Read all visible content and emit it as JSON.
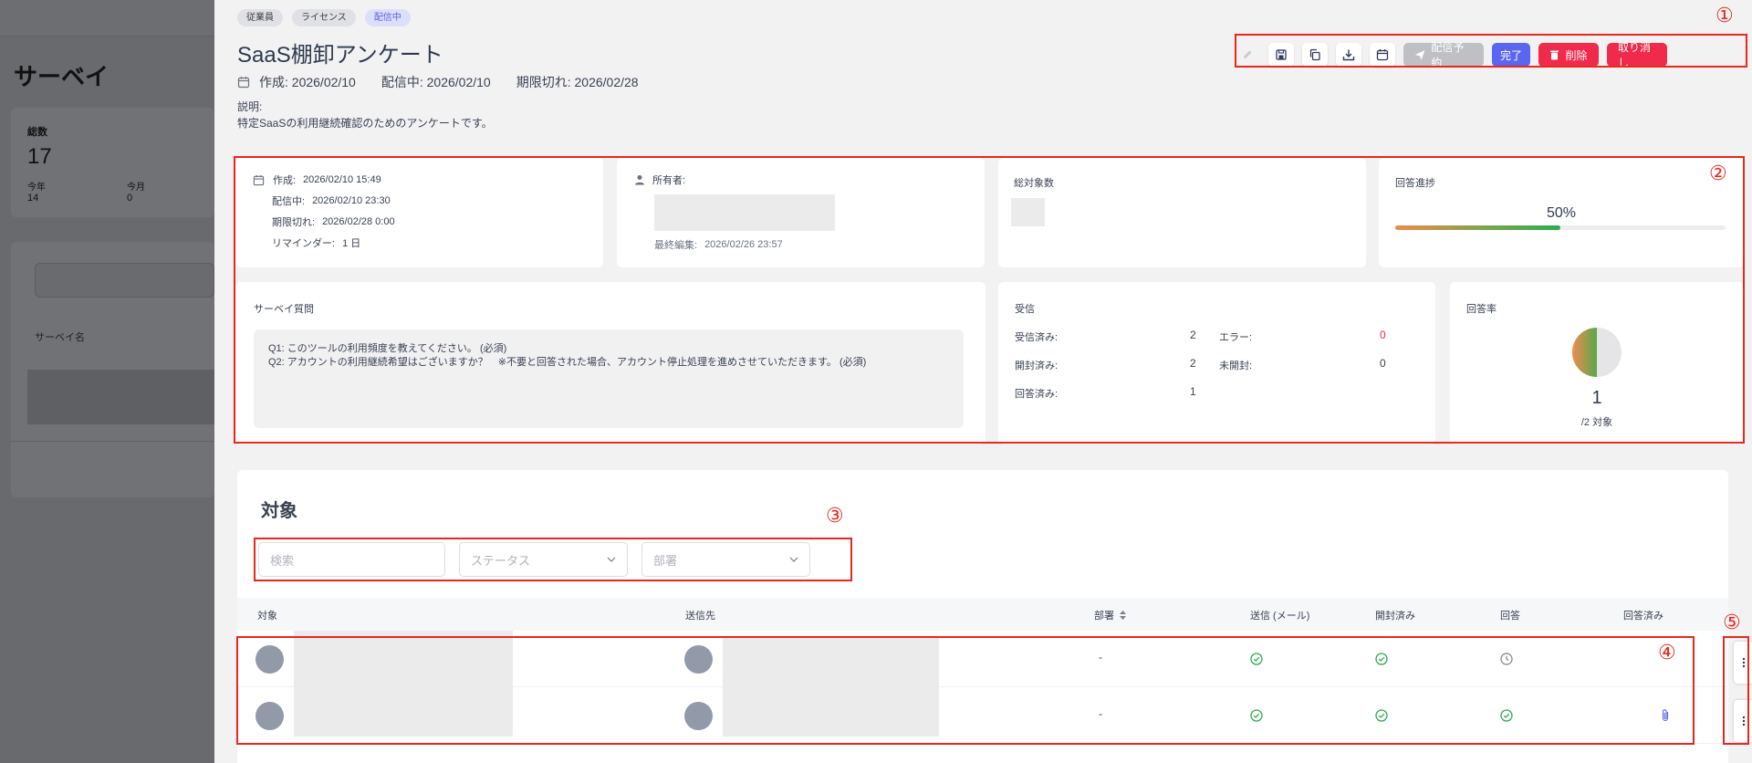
{
  "background": {
    "title": "サーベイ",
    "card_label": "総数",
    "card_value": "17",
    "this_year_label": "今年",
    "this_year_value": "14",
    "this_month_label": "今月",
    "this_month_value": "0",
    "column_survey_name": "サーベイ名"
  },
  "tags": [
    "従業員",
    "ライセンス",
    "配信中"
  ],
  "title": "SaaS棚卸アンケート",
  "meta": {
    "created": "作成: 2026/02/10",
    "distributing": "配信中: 2026/02/10",
    "expires": "期限切れ: 2026/02/28"
  },
  "description": {
    "label": "説明:",
    "text": "特定SaaSの利用継続確認のためのアンケートです。"
  },
  "toolbar": {
    "icons": [
      "edit-icon",
      "save-icon",
      "copy-icon",
      "download-icon",
      "calendar-icon"
    ],
    "schedule_label": "配信予約",
    "complete_label": "完了",
    "delete_label": "削除",
    "cancel_label": "取り消し"
  },
  "dates_card": {
    "created_label": "作成:",
    "created_value": "2026/02/10 15:49",
    "distributing_label": "配信中:",
    "distributing_value": "2026/02/10 23:30",
    "expires_label": "期限切れ:",
    "expires_value": "2026/02/28 0:00",
    "reminder_label": "リマインダー:",
    "reminder_value": "1 日"
  },
  "owner_card": {
    "label": "所有者:",
    "last_edit_label": "最終編集:",
    "last_edit_value": "2026/02/26 23:57"
  },
  "total_targets_card": {
    "label": "総対象数"
  },
  "progress_card": {
    "label": "回答進捗",
    "percent_text": "50%",
    "percent": 50
  },
  "questions_card": {
    "label": "サーベイ質問",
    "q1": "Q1:  このツールの利用頻度を教えてください。 (必須)",
    "q2": "Q2:  アカウントの利用継続希望はございますか？　※不要と回答された場合、アカウント停止処理を進めさせていただきます。 (必須)"
  },
  "receipt_card": {
    "label": "受信",
    "received_label": "受信済み:",
    "received_value": "2",
    "opened_label": "開封済み:",
    "opened_value": "2",
    "answered_label": "回答済み:",
    "answered_value": "1",
    "error_label": "エラー:",
    "error_value": "0",
    "unopened_label": "未開封:",
    "unopened_value": "0"
  },
  "rate_card": {
    "label": "回答率",
    "answered": "1",
    "total_text": "/2 対象",
    "fraction": 0.5
  },
  "targets": {
    "heading": "対象",
    "search_placeholder": "検索",
    "status_placeholder": "ステータス",
    "department_placeholder": "部署",
    "columns": [
      "対象",
      "送信先",
      "部署",
      "送信 (メール)",
      "開封済み",
      "回答",
      "回答済み"
    ],
    "rows": [
      {
        "department": "-",
        "sent": "check",
        "opened": "check",
        "answered": "clock",
        "answered_file": ""
      },
      {
        "department": "-",
        "sent": "check",
        "opened": "check",
        "answered": "check",
        "answered_file": "paperclip"
      }
    ]
  },
  "annotations": [
    "①",
    "②",
    "③",
    "④",
    "⑤"
  ],
  "colors": {
    "accent_blue": "#5b66f0",
    "danger_red": "#ef2a4a",
    "success_green": "#2eab4e",
    "annotation_red": "#e8271d"
  }
}
